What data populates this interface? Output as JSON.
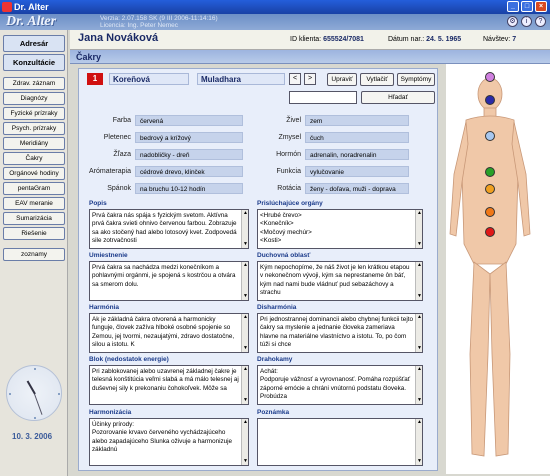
{
  "window": {
    "title": "Dr. Alter"
  },
  "header": {
    "logo": "Dr. Alter",
    "version_line": "Verzia: 2.07.158 SK (9 III 2006-11:14:16)",
    "license_line": "Licencia:    Ing. Peter Nemec"
  },
  "sidebar": {
    "top_buttons": [
      "Adresár",
      "Konzultácie"
    ],
    "items": [
      "Zdrav. záznam",
      "Diagnózy",
      "Fyzické prízraky",
      "Psych. prízraky",
      "Meridiány",
      "Čakry",
      "Orgánové hodiny",
      "pentaGram",
      "EAV meranie",
      "Sumarizácia",
      "Riešenie"
    ],
    "bottom": "zoznamy",
    "date": "10. 3. 2006"
  },
  "patient": {
    "name": "Jana Nováková",
    "id_label": "ID klienta:",
    "id": "655524/7081",
    "dob_label": "Dátum nar.:",
    "dob": "24. 5. 1965",
    "visits_label": "Návštev:",
    "visits": "7"
  },
  "section": {
    "title": "Čakry"
  },
  "chakra": {
    "number": "1",
    "name_sk": "Koreňová",
    "name_skt": "Muladhara",
    "prev": "<",
    "next": ">",
    "buttons": [
      "Upraviť",
      "Vytlačiť",
      "Symptómy"
    ],
    "search_button": "Hľadať",
    "search_value": ""
  },
  "properties_left": [
    {
      "label": "Farba",
      "value": "červená"
    },
    {
      "label": "Pletenec",
      "value": "bedrový a krížový"
    },
    {
      "label": "Žľaza",
      "value": "nadobličky - dreň"
    },
    {
      "label": "Arómaterapia",
      "value": "cédrové drevo, klinček"
    },
    {
      "label": "Spánok",
      "value": "na bruchu 10-12 hodín"
    }
  ],
  "properties_right": [
    {
      "label": "Živel",
      "value": "zem"
    },
    {
      "label": "Zmysel",
      "value": "čuch"
    },
    {
      "label": "Hormón",
      "value": "adrenalin, noradrenalin"
    },
    {
      "label": "Funkcia",
      "value": "vylučovanie"
    },
    {
      "label": "Rotácia",
      "value": "ženy - doľava, muži - doprava"
    }
  ],
  "fields": {
    "popis": {
      "label": "Popis",
      "text": "Prvá čakra nás spája s fyzickým svetom. Aktívna prvá čakra svieti ohnivo červenou farbou. Zobrazuje sa ako stočený had alebo lotosový kvet. Zodpovedá sile zotrvačnosti"
    },
    "organy": {
      "label": "Prislúchajúce orgány",
      "text": "<Hrubé črevo>\n<Konečník>\n<Močový mechúr>\n<Kosti>"
    },
    "umiestnenie": {
      "label": "Umiestnenie",
      "text": "Prvá čakra sa nachádza medzi konečníkom a pohlavnými orgánmi, je spojená s kostrčou a otvára sa smerom dolu."
    },
    "duchovna": {
      "label": "Duchovná oblasť",
      "text": "Kým nepochopíme, že náš život je len krátkou etapou v nekonečnom vývoji, kým sa neprestaneme ôn báť, kým nad nami bude vládnuť pud sebazáchovy a strachu"
    },
    "harmonia": {
      "label": "Harmónia",
      "text": "Ak je základná čakra otvorená a harmonicky funguje, človek zažíva hlboké osobné spojenie so Zemou, jej tvormi, nezaujatými, zdravo dostatočne, silou a istotu. K"
    },
    "disharmonia": {
      "label": "Disharmónia",
      "text": "Pri jednostrannej dominancii alebo chybnej funkcii tejto čakry sa myslenie a jednanie človeka zameriava hlavne na materiálne vlastníctvo a istotu. To, po čom túži si chce"
    },
    "blok": {
      "label": "Blok (nedostatok energie)",
      "text": "Pri zablokovanej alebo uzavrenej základnej čakre je telesná konštitúcia veľmi slabá a má málo telesnej aj duševnej sily k prekonaniu čohokoľvek. Môže sa"
    },
    "drahokamy": {
      "label": "Drahokamy",
      "text": "Achát:\nPodporuje vážnosť a vyrovnanosť. Pomáha rozpúšťať záporné emócie a chráni vnútornú podstatu človeka. Probúdza"
    },
    "harmonizacia": {
      "label": "Harmonizácia",
      "text": "Účinky prírody:\nPozorovanie krvavo červeného vychádzajúceho alebo zapadajúceho Slunka oživuje a harmonizuje základnú"
    },
    "poznamka": {
      "label": "Poznámka",
      "text": ""
    }
  },
  "chakra_colors": [
    "#d080e0",
    "#2a2aa8",
    "#a8c8f0",
    "#28a028",
    "#f0a020",
    "#f07818",
    "#e01818"
  ]
}
